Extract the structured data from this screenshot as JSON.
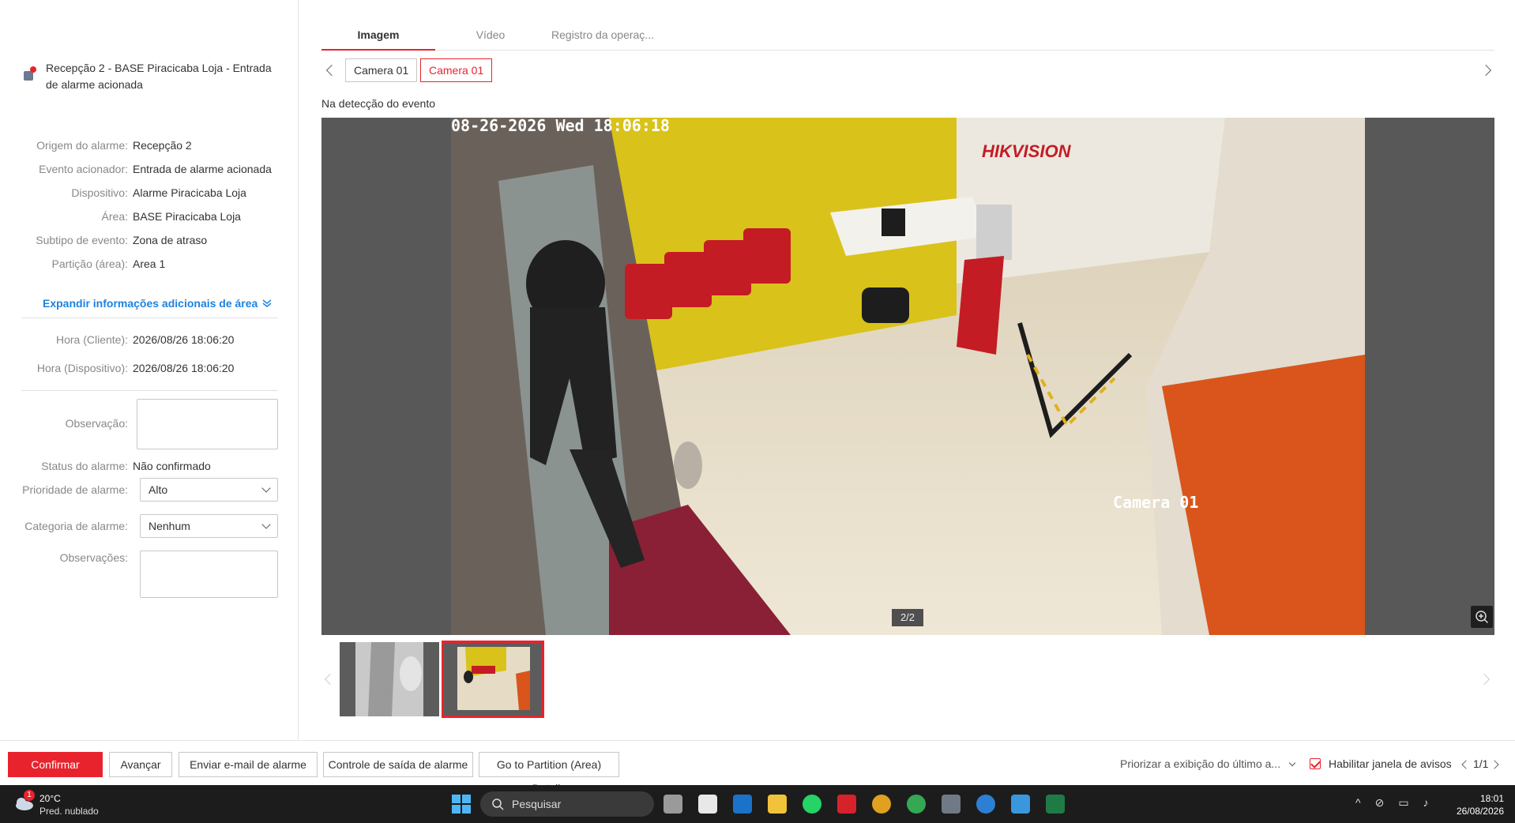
{
  "alarm": {
    "title": "Recepção 2 - BASE Piracicaba Loja - Entrada de alarme acionada"
  },
  "details": [
    {
      "label": "Origem do alarme:",
      "value": "Recepção 2"
    },
    {
      "label": "Evento acionador:",
      "value": "Entrada de alarme acionada"
    },
    {
      "label": "Dispositivo:",
      "value": "Alarme Piracicaba Loja"
    },
    {
      "label": "Área:",
      "value": "BASE Piracicaba Loja"
    },
    {
      "label": "Subtipo de evento:",
      "value": "Zona de atraso"
    },
    {
      "label": "Partição (área):",
      "value": "Area 1"
    }
  ],
  "expand_label": "Expandir informações adicionais de área",
  "times": [
    {
      "label": "Hora (Cliente):",
      "value": "2026/08/26 18:06:20"
    },
    {
      "label": "Hora (Dispositivo):",
      "value": "2026/08/26 18:06:20"
    }
  ],
  "form": {
    "observation_label": "Observação:",
    "status_label": "Status do alarme:",
    "status_value": "Não confirmado",
    "priority_label": "Prioridade de alarme:",
    "priority_value": "Alto",
    "category_label": "Categoria de alarme:",
    "category_value": "Nenhum",
    "remarks_label": "Observações:"
  },
  "tabs": [
    {
      "label": "Imagem",
      "active": true
    },
    {
      "label": "Vídeo",
      "active": false
    },
    {
      "label": "Registro da operaç...",
      "active": false
    }
  ],
  "cameras": [
    {
      "label": "Camera 01",
      "selected": false
    },
    {
      "label": "Camera 01",
      "selected": true
    }
  ],
  "viewer": {
    "caption": "Na detecção do evento",
    "osd_timestamp": "08-26-2026 Wed 18:06:18",
    "osd_brand": "HIKVISION",
    "osd_camera": "Camera 01",
    "counter": "2/2"
  },
  "bottom": {
    "confirm": "Confirmar",
    "advance": "Avançar",
    "send_email": "Enviar e-mail de alarme",
    "output_control": "Controle de saída de alarme",
    "partition_details": "Go to Partition (Area) Details",
    "prioritize": "Priorizar a exibição do último a...",
    "enable_popup": "Habilitar janela de avisos",
    "paging": "1/1"
  },
  "taskbar": {
    "weather_temp": "20°C",
    "weather_desc": "Pred. nublado",
    "weather_badge": "1",
    "search": "Pesquisar",
    "time": "18:01",
    "date": "26/08/2026"
  },
  "colors": {
    "accent": "#e8232d",
    "link": "#1d82e0",
    "taskbar": "#1c1c1c"
  }
}
